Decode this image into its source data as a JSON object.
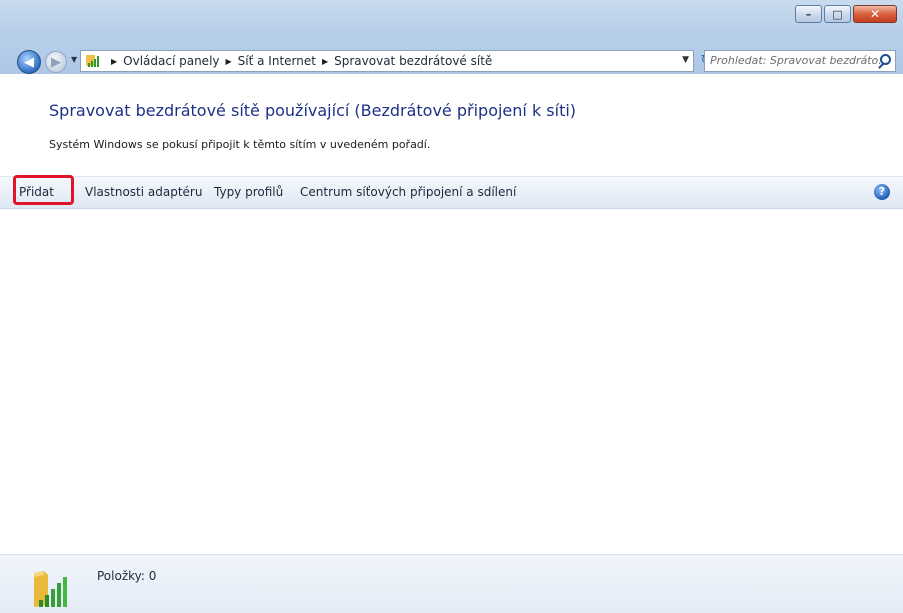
{
  "window": {
    "caption_buttons": {
      "minimize": "–",
      "maximize": "□",
      "close": "✕"
    }
  },
  "navigation": {
    "back_icon": "back-arrow-icon",
    "forward_icon": "forward-arrow-icon",
    "breadcrumbs": [
      "Ovládací panely",
      "Síť a Internet",
      "Spravovat bezdrátové sítě"
    ],
    "search_placeholder": "Prohledat: Spravovat bezdráto..."
  },
  "main": {
    "heading": "Spravovat bezdrátové sítě používající (Bezdrátové připojení k síti)",
    "subtext": "Systém Windows se pokusí připojit k těmto sítím v uvedeném pořadí."
  },
  "toolbar": {
    "add_label": "Přidat",
    "adapter_label": "Vlastnosti adaptéru",
    "profiles_label": "Typy profilů",
    "center_label": "Centrum síťových připojení a sdílení",
    "help_glyph": "?"
  },
  "status_bar": {
    "items_text": "Položky: 0",
    "icon": "wireless-network-folder-icon"
  },
  "colors": {
    "heading": "#1e3287",
    "highlight_border": "#e0142b",
    "frame": "#b9d0ea"
  }
}
